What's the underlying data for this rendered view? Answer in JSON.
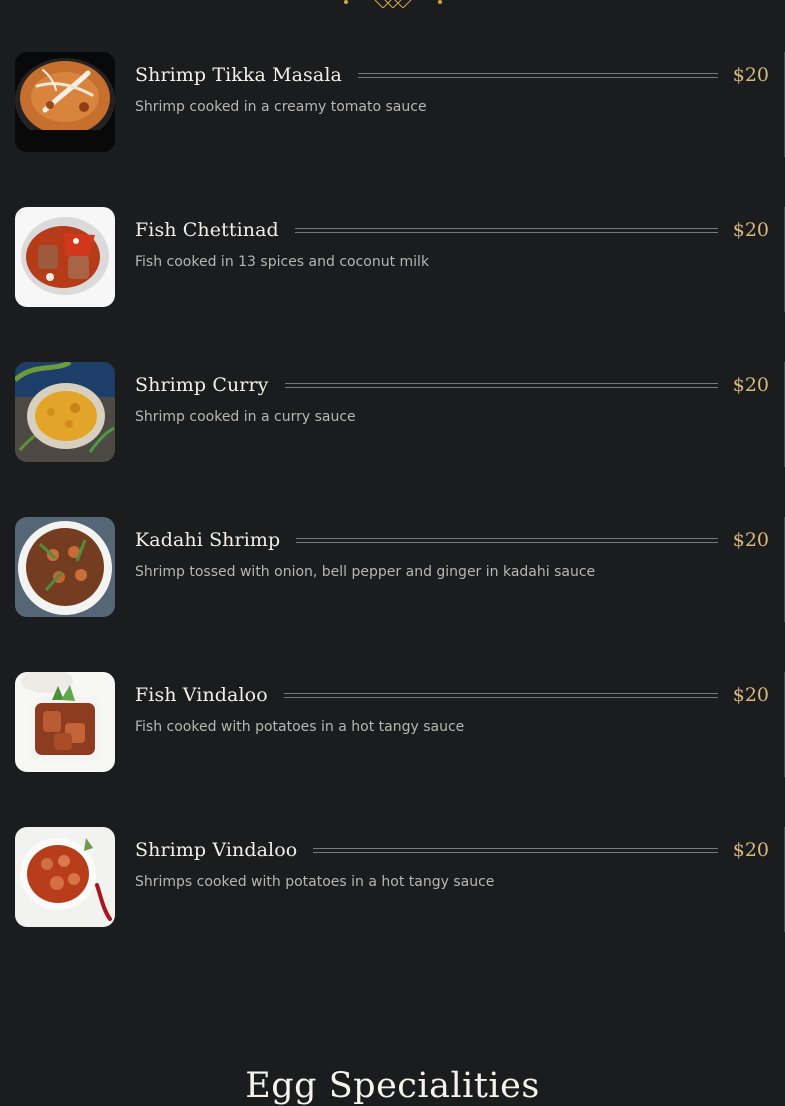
{
  "menu": {
    "items": [
      {
        "name": "Shrimp Tikka Masala",
        "price": "$20",
        "description": "Shrimp cooked in a creamy tomato sauce",
        "image_icon": "shrimp-tikka-masala-photo"
      },
      {
        "name": "Fish Chettinad",
        "price": "$20",
        "description": "Fish cooked in 13 spices and coconut milk",
        "image_icon": "fish-chettinad-photo"
      },
      {
        "name": "Shrimp Curry",
        "price": "$20",
        "description": "Shrimp cooked in a curry sauce",
        "image_icon": "shrimp-curry-photo"
      },
      {
        "name": "Kadahi Shrimp",
        "price": "$20",
        "description": "Shrimp tossed with onion, bell pepper and ginger in kadahi sauce",
        "image_icon": "kadahi-shrimp-photo"
      },
      {
        "name": "Fish Vindaloo",
        "price": "$20",
        "description": "Fish cooked with potatoes in a hot tangy sauce",
        "image_icon": "fish-vindaloo-photo"
      },
      {
        "name": "Shrimp Vindaloo",
        "price": "$20",
        "description": "Shrimps cooked with potatoes in a hot tangy sauce",
        "image_icon": "shrimp-vindaloo-photo"
      }
    ]
  },
  "next_section": {
    "title": "Egg Specialities"
  },
  "colors": {
    "background": "#1b1c1e",
    "name_text": "#f3efe8",
    "price_text": "#d9b87b",
    "description_text": "#b8b6b2",
    "rule_line": "#77787b",
    "ornament": "#d6a645"
  }
}
